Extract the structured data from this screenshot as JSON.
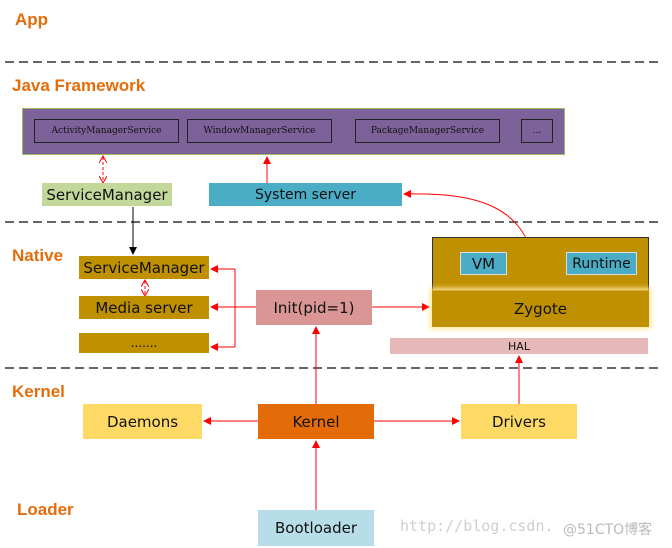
{
  "layers": {
    "app": "App",
    "java": "Java Framework",
    "native": "Native",
    "kernel": "Kernel",
    "loader": "Loader"
  },
  "java_framework": {
    "services": [
      "ActivityManagerService",
      "WindowManagerService",
      "PackageManagerService",
      "..."
    ],
    "service_manager": "ServiceManager",
    "system_server": "System server"
  },
  "native": {
    "service_manager": "ServiceManager",
    "media_server": "Media server",
    "more": ".......",
    "init": "Init(pid=1)",
    "vm": "VM",
    "runtime": "Runtime",
    "zygote": "Zygote",
    "hal": "HAL"
  },
  "kernel": {
    "daemons": "Daemons",
    "kernel": "Kernel",
    "drivers": "Drivers"
  },
  "loader": {
    "bootloader": "Bootloader"
  },
  "watermark": {
    "url": "http://blog.csdn.",
    "site": "@51CTO博客"
  },
  "colors": {
    "label": "#e46c0a",
    "framework": "#7d6299",
    "service_manager_java": "#c4d79b",
    "system_server": "#4bacc6",
    "native_gold": "#bf9000",
    "init": "#d99694",
    "hal": "#e6b9b8",
    "daemons": "#ffd966",
    "kernel": "#e36c09",
    "bootloader": "#b7dde8",
    "arrow": "#ff0000"
  }
}
